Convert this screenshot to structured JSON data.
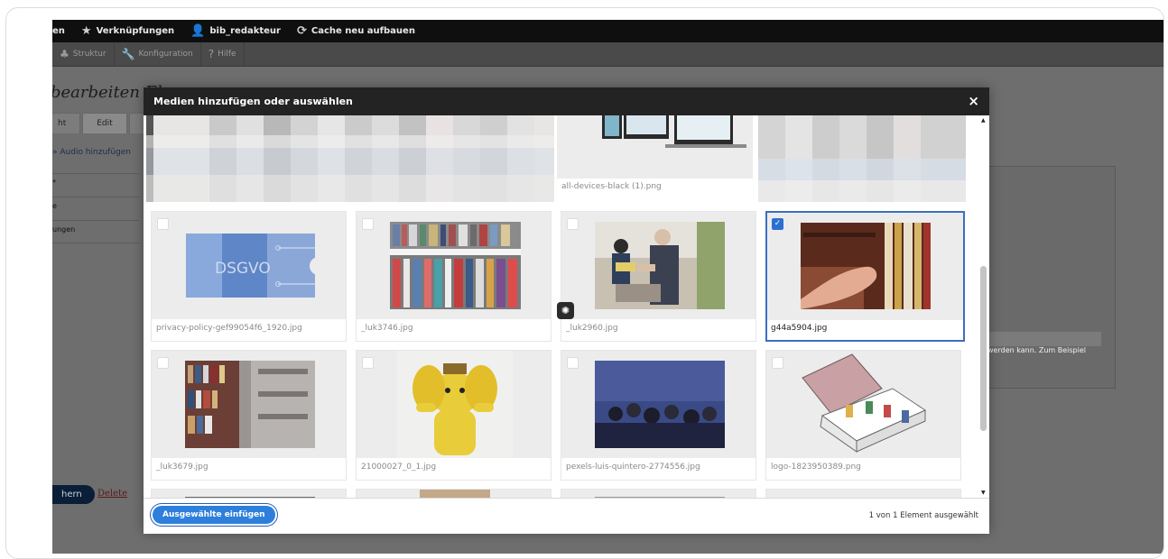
{
  "toolbar": {
    "partial_left": "en",
    "shortcuts": "Verknüpfungen",
    "user": "bib_redakteur",
    "cache": "Cache neu aufbauen"
  },
  "tray": {
    "struktur": "Struktur",
    "konfiguration": "Konfiguration",
    "hilfe": "Hilfe",
    "right_edge": "|"
  },
  "background": {
    "title": "bearbeiten Ele",
    "tabs": [
      "ht",
      "Edit",
      "D"
    ],
    "link": "» Audio hinzufügen",
    "rows": [
      "*",
      "e",
      "ungen"
    ],
    "hint": "werden kann. Zum Beispiel",
    "save": "hern",
    "delete": "Delete"
  },
  "dialog": {
    "title": "Medien hinzufügen oder auswählen",
    "close": "×",
    "insert_button": "Ausgewählte einfügen",
    "selection_count": "1 von 1 Element ausgewählt"
  },
  "media": [
    {
      "label": "all-devices-black (1).png",
      "selected": false
    },
    {
      "label": "privacy-policy-gef99054f6_1920.jpg",
      "selected": false
    },
    {
      "label": "_luk3746.jpg",
      "selected": false
    },
    {
      "label": "_luk2960.jpg",
      "selected": false
    },
    {
      "label": "g44a5904.jpg",
      "selected": true
    },
    {
      "label": "_luk3679.jpg",
      "selected": false
    },
    {
      "label": "21000027_0_1.jpg",
      "selected": false
    },
    {
      "label": "pexels-luis-quintero-2774556.jpg",
      "selected": false
    },
    {
      "label": "logo-1823950389.png",
      "selected": false
    }
  ],
  "images": {
    "dsgvo_text": "DSGVO"
  },
  "colors": {
    "accent": "#2d7fdb",
    "selected_border": "#3a6fbf",
    "dialog_header": "#232323",
    "toolbar": "#0f0f0f"
  }
}
